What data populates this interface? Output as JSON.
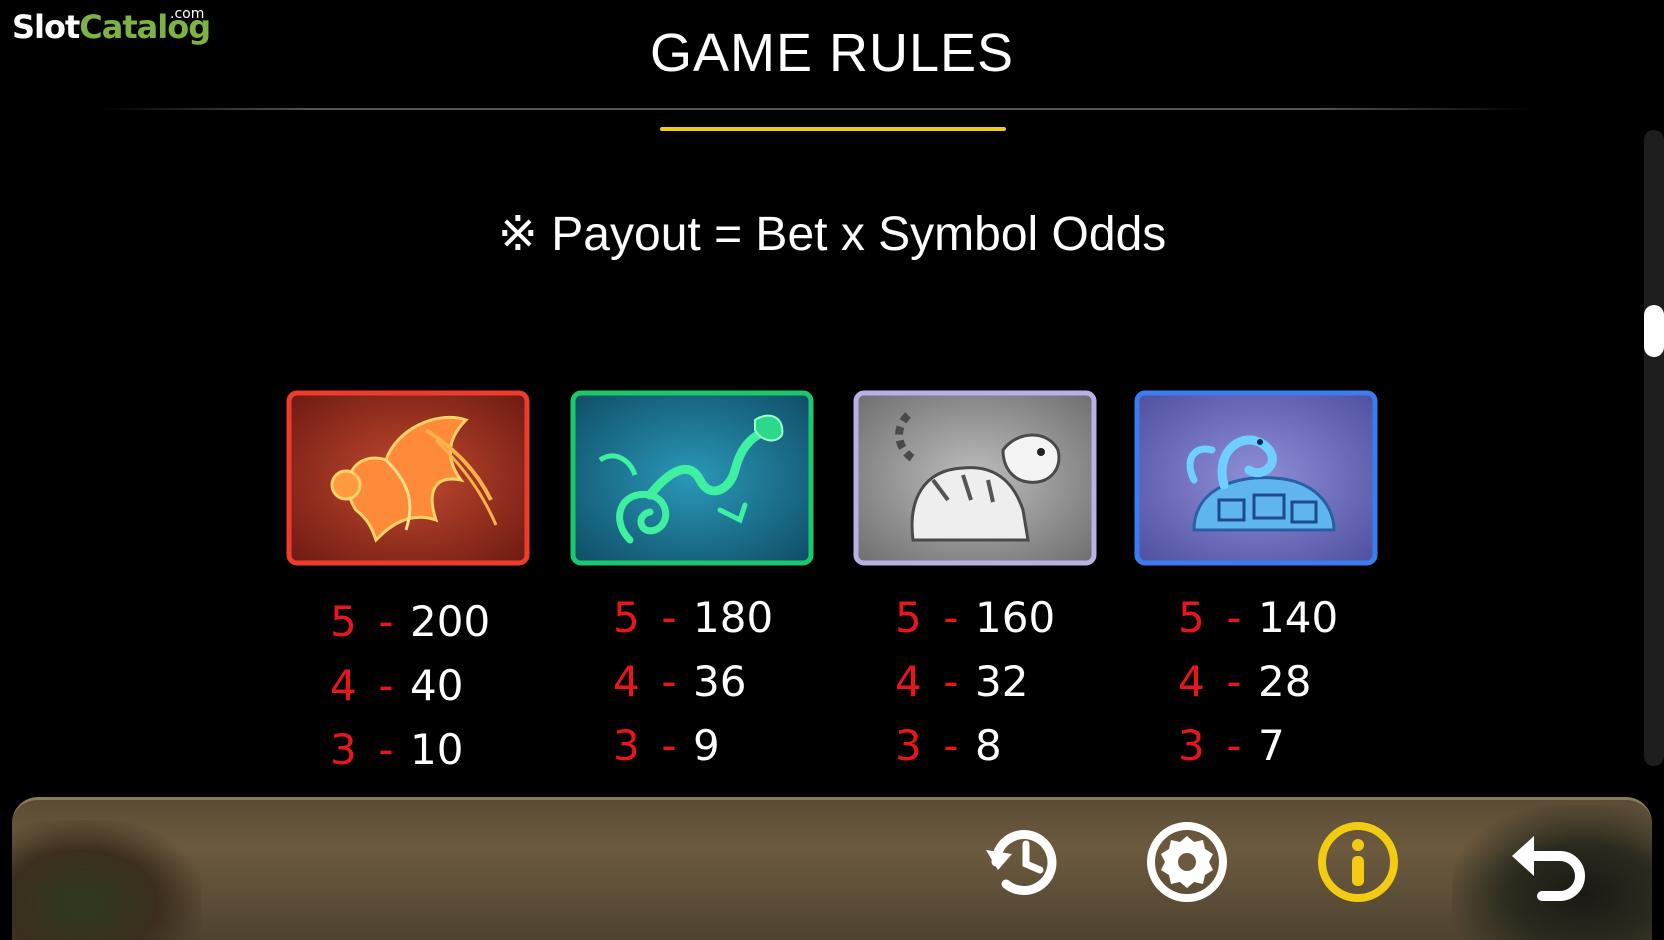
{
  "branding": {
    "name_part1": "Slot",
    "name_part2": "Catalog",
    "tld": ".com",
    "accent_color": "#7cb342"
  },
  "header": {
    "title": "GAME RULES",
    "underline_color": "#f2cc13"
  },
  "formula": {
    "text": "※ Payout = Bet x Symbol Odds"
  },
  "symbols": [
    {
      "icon": "phoenix-icon",
      "border_color": "#e83a2a",
      "payouts": [
        {
          "count": "5",
          "value": "200"
        },
        {
          "count": "4",
          "value": "40"
        },
        {
          "count": "3",
          "value": "10"
        }
      ]
    },
    {
      "icon": "dragon-icon",
      "border_color": "#1cc96a",
      "payouts": [
        {
          "count": "5",
          "value": "180"
        },
        {
          "count": "4",
          "value": "36"
        },
        {
          "count": "3",
          "value": "9"
        }
      ]
    },
    {
      "icon": "tiger-icon",
      "border_color": "#b9b0e6",
      "payouts": [
        {
          "count": "5",
          "value": "160"
        },
        {
          "count": "4",
          "value": "32"
        },
        {
          "count": "3",
          "value": "8"
        }
      ]
    },
    {
      "icon": "turtle-snake-icon",
      "border_color": "#3a7df0",
      "payouts": [
        {
          "count": "5",
          "value": "140"
        },
        {
          "count": "4",
          "value": "28"
        },
        {
          "count": "3",
          "value": "7"
        }
      ]
    }
  ],
  "payout_dash": "-",
  "controls": [
    {
      "icon": "history-icon",
      "color": "#ffffff"
    },
    {
      "icon": "settings-icon",
      "color": "#ffffff"
    },
    {
      "icon": "info-icon",
      "color": "#f2cc13",
      "active": true
    },
    {
      "icon": "back-icon",
      "color": "#ffffff"
    }
  ]
}
